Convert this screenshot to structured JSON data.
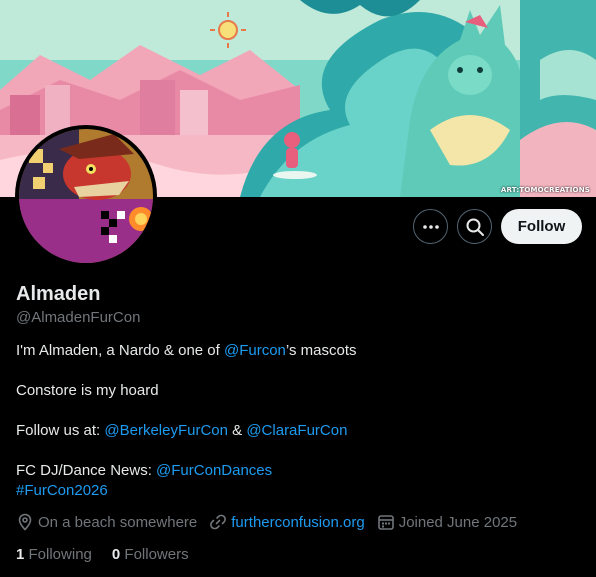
{
  "banner": {
    "credit": "ART:TOMOCREATIONS"
  },
  "actions": {
    "follow_label": "Follow"
  },
  "profile": {
    "name": "Almaden",
    "handle": "@AlmadenFurCon"
  },
  "bio": {
    "line1_prefix": "I'm Almaden, a Nardo & one of ",
    "line1_mention": "@Furcon",
    "line1_suffix": "’s mascots",
    "line2": "Constore is my hoard",
    "line3_prefix": "Follow us at: ",
    "line3_mention1": "@BerkeleyFurCon",
    "line3_and": " & ",
    "line3_mention2": "@ClaraFurCon",
    "line4_prefix": "FC DJ/Dance News: ",
    "line4_mention": "@FurConDances",
    "hashtag": "#FurCon2026"
  },
  "meta": {
    "location": "On a beach somewhere",
    "website": "furtherconfusion.org",
    "joined": "Joined June 2025"
  },
  "stats": {
    "following_count": "1",
    "following_label": "Following",
    "followers_count": "0",
    "followers_label": "Followers"
  },
  "colors": {
    "link": "#1d9bf0",
    "secondary_text": "#71767b",
    "primary_text": "#e7e9ea",
    "follow_bg": "#eff3f4"
  },
  "icons": [
    "more-icon",
    "search-icon",
    "location-icon",
    "link-icon",
    "calendar-icon"
  ]
}
